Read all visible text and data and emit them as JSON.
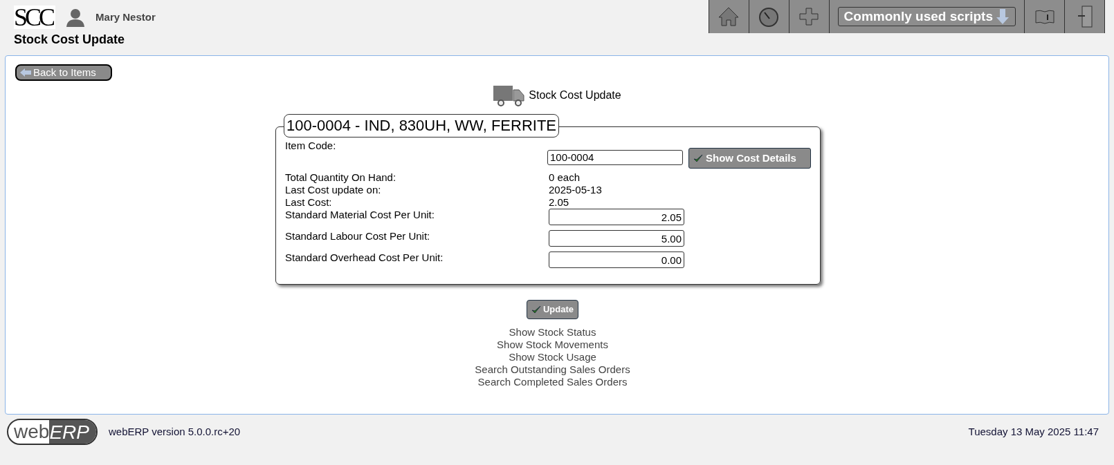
{
  "header": {
    "logo": "SCC",
    "user": "Mary Nestor",
    "title": "Stock Cost Update"
  },
  "toolbar": {
    "scripts_menu": "Commonly used scripts"
  },
  "back_button": "Back to Items",
  "page_heading": "Stock Cost Update",
  "item": {
    "legend": "100-0004 - IND, 830UH, WW, FERRITE",
    "rows": [
      {
        "kind": "lookup",
        "label": "Item Code:",
        "value": "100-0004",
        "button": "Show Cost Details"
      },
      {
        "kind": "text",
        "label": "Total Quantity On Hand:",
        "value": "0 each"
      },
      {
        "kind": "text",
        "label": "Last Cost update on:",
        "value": "2025-05-13"
      },
      {
        "kind": "text",
        "label": "Last Cost:",
        "value": "2.05"
      },
      {
        "kind": "number",
        "label": "Standard Material Cost Per Unit:",
        "value": "2.05"
      },
      {
        "kind": "number",
        "label": "Standard Labour Cost Per Unit:",
        "value": "5.00"
      },
      {
        "kind": "number",
        "label": "Standard Overhead Cost Per Unit:",
        "value": "0.00"
      }
    ]
  },
  "update_button": "Update",
  "links": [
    "Show Stock Status",
    "Show Stock Movements",
    "Show Stock Usage",
    "Search Outstanding Sales Orders",
    "Search Completed Sales Orders"
  ],
  "footer": {
    "logo_left": "web",
    "logo_right": "ERP",
    "version": "webERP version 5.0.0.rc+20",
    "datetime": "Tuesday 13 May 2025 11:47"
  }
}
